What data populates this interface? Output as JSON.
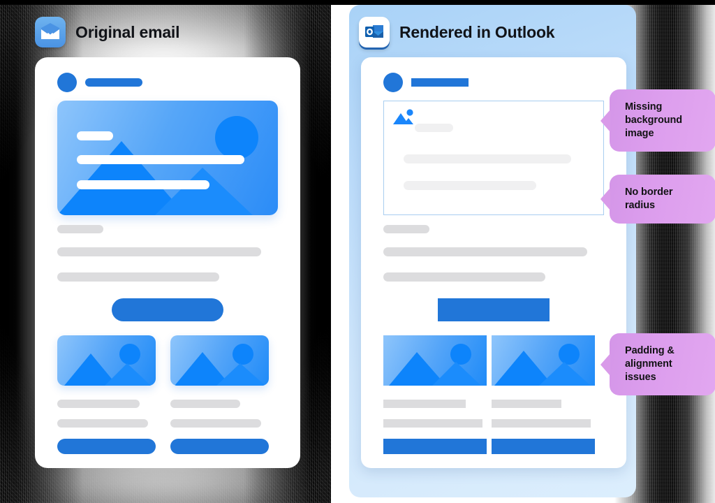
{
  "panels": {
    "original": {
      "title": "Original email",
      "icon": "mail-envelope-icon"
    },
    "outlook": {
      "title": "Rendered in Outlook",
      "icon": "outlook-logo-icon"
    }
  },
  "colors": {
    "brand_blue": "#2176d8",
    "hero_blue_light": "#8ec5fb",
    "hero_blue_dark": "#1f8bf8",
    "skeleton_gray": "#dcdcde",
    "skeleton_gray_light": "#f0f0f1",
    "callout_purple": "#d99ae9",
    "outlook_panel_blue": "#bcdcfa",
    "broken_box_border": "#a8cdf0"
  },
  "callouts": [
    {
      "id": "missing-background-image",
      "text": "Missing background image"
    },
    {
      "id": "no-border-radius",
      "text": "No border radius"
    },
    {
      "id": "padding-alignment-issues",
      "text": "Padding & alignment issues"
    }
  ],
  "email_content": {
    "sender_avatar": "avatar-circle",
    "sender_name_placeholder": "",
    "hero": {
      "original_render": "gradient background image with mountain and sun illustration, three white text bars",
      "outlook_render": "empty bordered box with broken image icon and gray placeholder bars"
    },
    "cta_label": "",
    "tiles": [
      {
        "id": "tile-a",
        "image": "mountain-photo-placeholder"
      },
      {
        "id": "tile-b",
        "image": "mountain-photo-placeholder"
      }
    ]
  }
}
